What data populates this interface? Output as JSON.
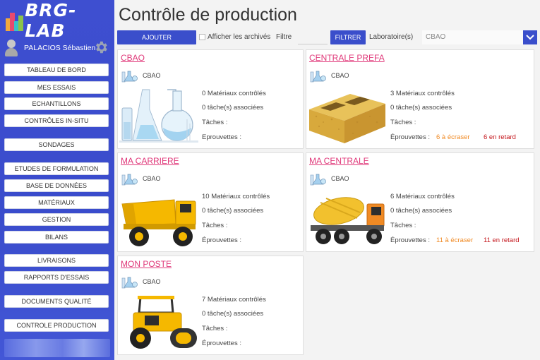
{
  "app": {
    "logo_text": "BRG-LAB"
  },
  "user": {
    "name": "PALACIOS Sébastien"
  },
  "sidebar": {
    "items": [
      {
        "label": "Tableau de bord"
      },
      {
        "label": "Mes essais"
      },
      {
        "label": "Echantillons"
      },
      {
        "label": "Contrôles in-situ"
      },
      {
        "label": "Sondages"
      },
      {
        "label": "Etudes de formulation"
      },
      {
        "label": "Base de données"
      },
      {
        "label": "Matériaux"
      },
      {
        "label": "Gestion"
      },
      {
        "label": "Bilans"
      },
      {
        "label": "Livraisons"
      },
      {
        "label": "Rapports d'essais"
      },
      {
        "label": "Documents qualité"
      },
      {
        "label": "Controle production"
      }
    ]
  },
  "page": {
    "title": "Contrôle de production"
  },
  "toolbar": {
    "add_label": "Ajouter",
    "archive_label": "Afficher les archivés",
    "filter_label": "Filtre",
    "filter_value": "",
    "filter_button": "Filtrer",
    "lab_label": "Laboratoire(s)",
    "lab_value": "CBAO"
  },
  "colors": {
    "accent": "#3a4ecb",
    "title_link": "#e0397a",
    "to_crush": "#f08a24",
    "late": "#c4161c"
  },
  "cards": [
    {
      "title": "CBAO",
      "lab": "CBAO",
      "materials": "0 Matériaux contrôlés",
      "tasks_assoc": "0 tâche(s) associées",
      "tasks_label": "Tâches :",
      "specimens_label": "Eprouvettes :",
      "to_crush": "",
      "late": "",
      "illustration": "lab-glassware-icon"
    },
    {
      "title": "CENTRALE PREFA",
      "lab": "CBAO",
      "materials": "3 Matériaux contrôlés",
      "tasks_assoc": "0 tâche(s) associées",
      "tasks_label": "Tâches :",
      "specimens_label": "Éprouvettes :",
      "to_crush": "6 à écraser",
      "late": "6 en retard",
      "illustration": "concrete-block-icon"
    },
    {
      "title": "MA CARRIERE",
      "lab": "CBAO",
      "materials": "10 Matériaux contrôlés",
      "tasks_assoc": "0 tâche(s) associées",
      "tasks_label": "Tâches :",
      "specimens_label": "Éprouvettes :",
      "to_crush": "",
      "late": "",
      "illustration": "dump-truck-icon"
    },
    {
      "title": "MA CENTRALE",
      "lab": "CBAO",
      "materials": "6 Matériaux contrôlés",
      "tasks_assoc": "0 tâche(s) associées",
      "tasks_label": "Tâches :",
      "specimens_label": "Éprouvettes :",
      "to_crush": "11 à écraser",
      "late": "11 en retard",
      "illustration": "concrete-mixer-truck-icon"
    },
    {
      "title": "MON POSTE",
      "lab": "CBAO",
      "materials": "7 Matériaux contrôlés",
      "tasks_assoc": "0 tâche(s) associées",
      "tasks_label": "Tâches :",
      "specimens_label": "Éprouvettes :",
      "to_crush": "",
      "late": "",
      "illustration": "road-roller-icon"
    }
  ]
}
